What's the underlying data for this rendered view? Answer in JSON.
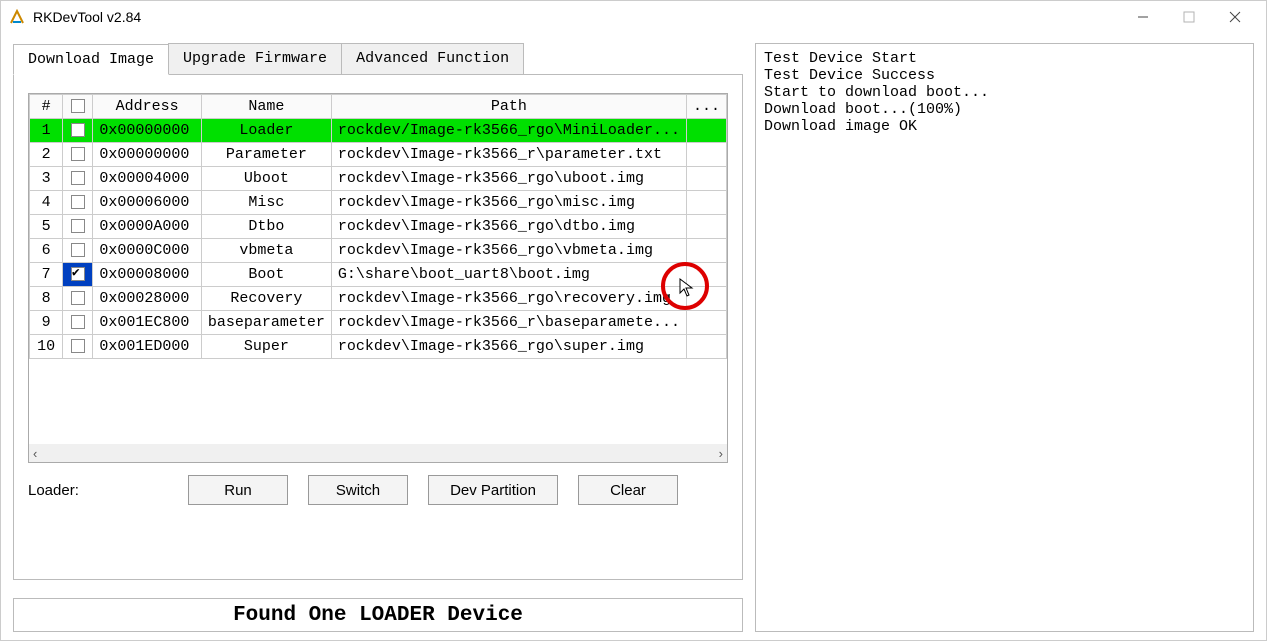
{
  "window": {
    "title": "RKDevTool v2.84"
  },
  "tabs": {
    "download": "Download Image",
    "upgrade": "Upgrade Firmware",
    "advanced": "Advanced Function"
  },
  "grid": {
    "headers": {
      "num": "#",
      "addr": "Address",
      "name": "Name",
      "path": "Path",
      "dots": "..."
    },
    "rows": [
      {
        "n": "1",
        "chk": false,
        "sel": true,
        "addr": "0x00000000",
        "name": "Loader",
        "path": "rockdev/Image-rk3566_rgo\\MiniLoader..."
      },
      {
        "n": "2",
        "chk": false,
        "sel": false,
        "addr": "0x00000000",
        "name": "Parameter",
        "path": "rockdev\\Image-rk3566_r\\parameter.txt"
      },
      {
        "n": "3",
        "chk": false,
        "sel": false,
        "addr": "0x00004000",
        "name": "Uboot",
        "path": "rockdev\\Image-rk3566_rgo\\uboot.img"
      },
      {
        "n": "4",
        "chk": false,
        "sel": false,
        "addr": "0x00006000",
        "name": "Misc",
        "path": "rockdev\\Image-rk3566_rgo\\misc.img"
      },
      {
        "n": "5",
        "chk": false,
        "sel": false,
        "addr": "0x0000A000",
        "name": "Dtbo",
        "path": "rockdev\\Image-rk3566_rgo\\dtbo.img"
      },
      {
        "n": "6",
        "chk": false,
        "sel": false,
        "addr": "0x0000C000",
        "name": "vbmeta",
        "path": "rockdev\\Image-rk3566_rgo\\vbmeta.img"
      },
      {
        "n": "7",
        "chk": true,
        "sel": false,
        "addr": "0x00008000",
        "name": "Boot",
        "path": "G:\\share\\boot_uart8\\boot.img"
      },
      {
        "n": "8",
        "chk": false,
        "sel": false,
        "addr": "0x00028000",
        "name": "Recovery",
        "path": "rockdev\\Image-rk3566_rgo\\recovery.img"
      },
      {
        "n": "9",
        "chk": false,
        "sel": false,
        "addr": "0x001EC800",
        "name": "baseparameter",
        "path": "rockdev\\Image-rk3566_r\\baseparamete..."
      },
      {
        "n": "10",
        "chk": false,
        "sel": false,
        "addr": "0x001ED000",
        "name": "Super",
        "path": "rockdev\\Image-rk3566_rgo\\super.img"
      }
    ]
  },
  "loader_label": "Loader:",
  "buttons": {
    "run": "Run",
    "switch": "Switch",
    "dev": "Dev Partition",
    "clear": "Clear"
  },
  "status": "Found One LOADER Device",
  "log": "Test Device Start\nTest Device Success\nStart to download boot...\nDownload boot...(100%)\nDownload image OK"
}
